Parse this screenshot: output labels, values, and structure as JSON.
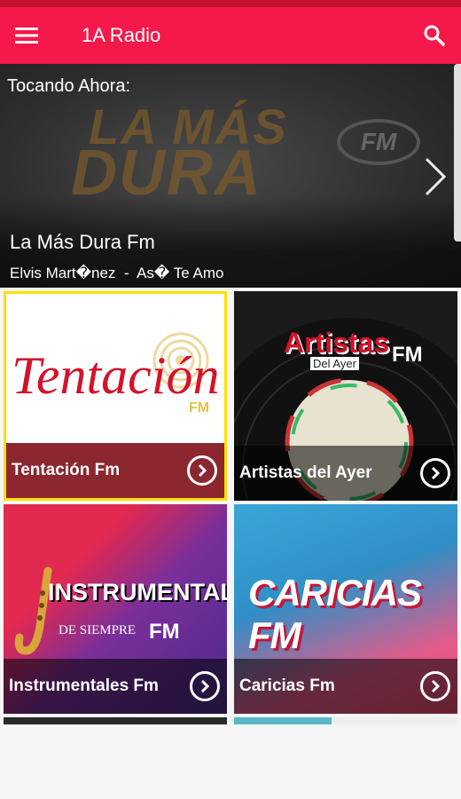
{
  "app": {
    "title": "1A Radio"
  },
  "now_playing": {
    "label": "Tocando Ahora:",
    "station": "La Más Dura Fm",
    "track": "Elvis Mart�nez  -  As� Te Amo",
    "logo_line1": "LA MÁS",
    "logo_line2": "DURA",
    "logo_badge": "FM"
  },
  "stations": [
    {
      "name": "Tentación Fm",
      "logo": "Tentación",
      "logo_sub": "FM"
    },
    {
      "name": "Artistas del Ayer",
      "logo": "Artistas",
      "logo_sub": "Del Ayer",
      "logo_badge": "FM"
    },
    {
      "name": "Instrumentales Fm",
      "logo": "INSTRUMENTALES",
      "logo_sub": "DE SIEMPRE",
      "logo_badge": "FM"
    },
    {
      "name": "Caricias Fm",
      "logo": "CARICIAS FM"
    }
  ],
  "colors": {
    "appbar": "#f4194a",
    "statusbar": "#c2102e",
    "tentacion_red": "#d4122a"
  },
  "icons": {
    "menu": "hamburger-icon",
    "search": "search-icon",
    "next": "chevron-right-icon",
    "go": "circle-chevron-right-icon"
  }
}
